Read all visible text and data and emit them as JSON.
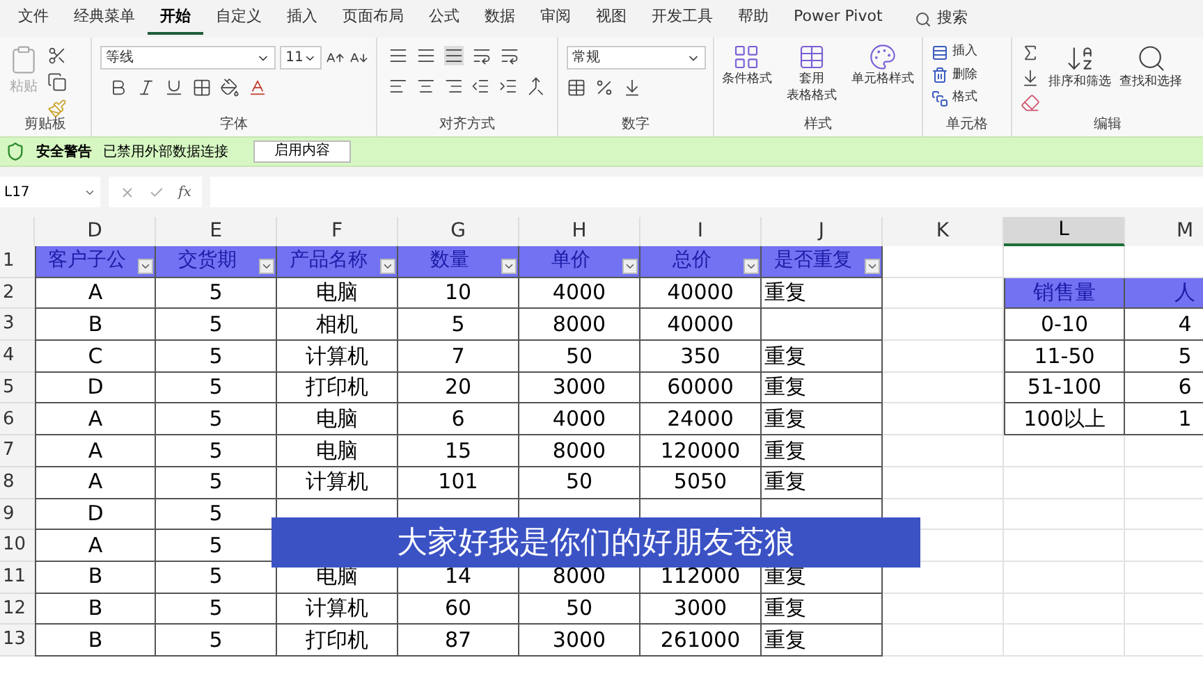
{
  "menu_tabs": [
    {
      "label": "文件",
      "selected": false
    },
    {
      "label": "经典菜单",
      "selected": false
    },
    {
      "label": "开始",
      "selected": true
    },
    {
      "label": "自定义",
      "selected": false
    },
    {
      "label": "插入",
      "selected": false
    },
    {
      "label": "页面布局",
      "selected": false
    },
    {
      "label": "公式",
      "selected": false
    },
    {
      "label": "数据",
      "selected": false
    },
    {
      "label": "审阅",
      "selected": false
    },
    {
      "label": "视图",
      "selected": false
    },
    {
      "label": "开发工具",
      "selected": false
    },
    {
      "label": "帮助",
      "selected": false
    },
    {
      "label": "Power Pivot",
      "selected": false
    }
  ],
  "search": {
    "label": "搜索"
  },
  "ribbon": {
    "clipboard": {
      "paste": "粘贴",
      "group": "剪贴板"
    },
    "font": {
      "font_name": "等线",
      "font_size": "11",
      "group": "字体"
    },
    "alignment": {
      "group": "对齐方式"
    },
    "number": {
      "format": "常规",
      "group": "数字"
    },
    "styles": {
      "buttons": [
        [
          "条件格式"
        ],
        [
          "套用",
          "表格格式"
        ],
        [
          "单元格样式"
        ]
      ],
      "group": "样式"
    },
    "cells": {
      "buttons": [
        "插入",
        "删除",
        "格式"
      ],
      "group": "单元格"
    },
    "editing": {
      "buttons": [
        "排序和筛选",
        "查找和选择"
      ],
      "group": "编辑"
    }
  },
  "security_bar": {
    "title": "安全警告",
    "message": "已禁用外部数据连接",
    "button": "启用内容"
  },
  "formula_bar": {
    "name_box": "L17",
    "function_label": "fx"
  },
  "sheet": {
    "columns": [
      {
        "label": "D",
        "selected": false
      },
      {
        "label": "E",
        "selected": false
      },
      {
        "label": "F",
        "selected": false
      },
      {
        "label": "G",
        "selected": false
      },
      {
        "label": "H",
        "selected": false
      },
      {
        "label": "I",
        "selected": false
      },
      {
        "label": "J",
        "selected": false
      },
      {
        "label": "K",
        "selected": false
      },
      {
        "label": "L",
        "selected": true
      },
      {
        "label": "M",
        "selected": false
      }
    ],
    "row_numbers": [
      "1",
      "2",
      "3",
      "4",
      "5",
      "6",
      "7",
      "8",
      "9",
      "10",
      "11",
      "12",
      "13"
    ],
    "data_table": {
      "header": [
        "客户子公",
        "交货期",
        "产品名称",
        "数量",
        "单价",
        "总价",
        "是否重复"
      ],
      "rows": [
        {
          "D": "A",
          "E": "5",
          "F": "电脑",
          "G": "10",
          "H": "4000",
          "I": "40000",
          "J": "重复"
        },
        {
          "D": "B",
          "E": "5",
          "F": "相机",
          "G": "5",
          "H": "8000",
          "I": "40000"
        },
        {
          "D": "C",
          "E": "5",
          "F": "计算机",
          "G": "7",
          "H": "50",
          "I": "350",
          "J": "重复"
        },
        {
          "D": "D",
          "E": "5",
          "F": "打印机",
          "G": "20",
          "H": "3000",
          "I": "60000",
          "J": "重复"
        },
        {
          "D": "A",
          "E": "5",
          "F": "电脑",
          "G": "6",
          "H": "4000",
          "I": "24000",
          "J": "重复"
        },
        {
          "D": "A",
          "E": "5",
          "F": "电脑",
          "G": "15",
          "H": "8000",
          "I": "120000",
          "J": "重复"
        },
        {
          "D": "A",
          "E": "5",
          "F": "计算机",
          "G": "101",
          "H": "50",
          "I": "5050",
          "J": "重复"
        },
        {
          "D": "D",
          "E": "5"
        },
        {
          "D": "A",
          "E": "5"
        },
        {
          "D": "B",
          "E": "5",
          "F": "电脑",
          "G": "14",
          "H": "8000",
          "I": "112000",
          "J": "重复"
        },
        {
          "D": "B",
          "E": "5",
          "F": "计算机",
          "G": "60",
          "H": "50",
          "I": "3000",
          "J": "重复"
        },
        {
          "D": "B",
          "E": "5",
          "F": "打印机",
          "G": "87",
          "H": "3000",
          "I": "261000",
          "J": "重复"
        }
      ]
    },
    "summary_table": {
      "header": [
        "销售量",
        "人"
      ],
      "rows": [
        [
          "0-10",
          "4"
        ],
        [
          "11-50",
          "5"
        ],
        [
          "51-100",
          "6"
        ],
        [
          "100以上",
          "1"
        ]
      ]
    }
  },
  "subtitle": "大家好我是你们的好朋友苍狼"
}
